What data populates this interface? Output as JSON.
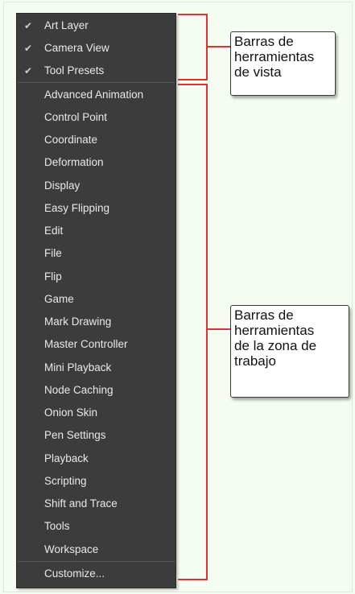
{
  "menu": {
    "checked_items": [
      {
        "label": "Art Layer",
        "checked": true
      },
      {
        "label": "Camera View",
        "checked": true
      },
      {
        "label": "Tool Presets",
        "checked": true
      }
    ],
    "items": [
      {
        "label": "Advanced Animation"
      },
      {
        "label": "Control Point"
      },
      {
        "label": "Coordinate"
      },
      {
        "label": "Deformation"
      },
      {
        "label": "Display"
      },
      {
        "label": "Easy Flipping"
      },
      {
        "label": "Edit"
      },
      {
        "label": "File"
      },
      {
        "label": "Flip"
      },
      {
        "label": "Game"
      },
      {
        "label": "Mark Drawing"
      },
      {
        "label": "Master Controller"
      },
      {
        "label": "Mini Playback"
      },
      {
        "label": "Node Caching"
      },
      {
        "label": "Onion Skin"
      },
      {
        "label": "Pen Settings"
      },
      {
        "label": "Playback"
      },
      {
        "label": "Scripting"
      },
      {
        "label": "Shift and Trace"
      },
      {
        "label": "Tools"
      },
      {
        "label": "Workspace"
      }
    ],
    "customize_label": "Customize..."
  },
  "check_glyph": "✔",
  "callouts": {
    "view_toolbars": "Barras de\nherramientas\nde vista",
    "workspace_toolbars": "Barras de\nherramientas\nde la zona de\ntrabajo"
  },
  "colors": {
    "menu_bg": "#3c3c3c",
    "menu_text": "#e9e9e9",
    "bracket": "#e53030",
    "page_bg": "#f5fdf2"
  }
}
